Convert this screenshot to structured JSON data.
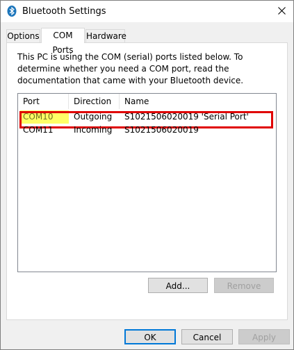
{
  "window": {
    "title": "Bluetooth Settings",
    "icon": "bluetooth-icon",
    "close_icon": "close-icon"
  },
  "tabs": [
    {
      "label": "Options",
      "active": false
    },
    {
      "label": "COM Ports",
      "active": true
    },
    {
      "label": "Hardware",
      "active": false
    }
  ],
  "panel": {
    "description": "This PC is using the COM (serial) ports listed below. To determine whether you need a COM port, read the documentation that came with your Bluetooth device."
  },
  "listview": {
    "columns": [
      "Port",
      "Direction",
      "Name"
    ],
    "rows": [
      {
        "port": "COM10",
        "direction": "Outgoing",
        "name": "S1021506020019 'Serial Port'",
        "highlighted": true
      },
      {
        "port": "COM11",
        "direction": "Incoming",
        "name": "S1021506020019",
        "highlighted": false
      }
    ]
  },
  "buttons": {
    "add": "Add...",
    "remove": "Remove",
    "ok": "OK",
    "cancel": "Cancel",
    "apply": "Apply"
  },
  "colors": {
    "highlight_yellow": "#ffff66",
    "annotation_red": "#e00000",
    "default_button_border": "#0078d7"
  }
}
